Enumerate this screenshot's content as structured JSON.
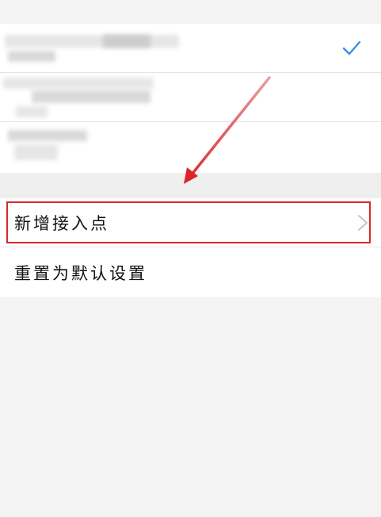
{
  "menu": {
    "add_apn_label": "新增接入点",
    "reset_default_label": "重置为默认设置"
  },
  "icons": {
    "selected_check": "checkmark-icon",
    "add_apn_chevron": "chevron-right-icon",
    "annotation": "arrow-annotation"
  },
  "colors": {
    "check_blue": "#3a8ee6",
    "annotation_red": "#d9252b",
    "background": "#f4f4f4",
    "card": "#ffffff"
  }
}
